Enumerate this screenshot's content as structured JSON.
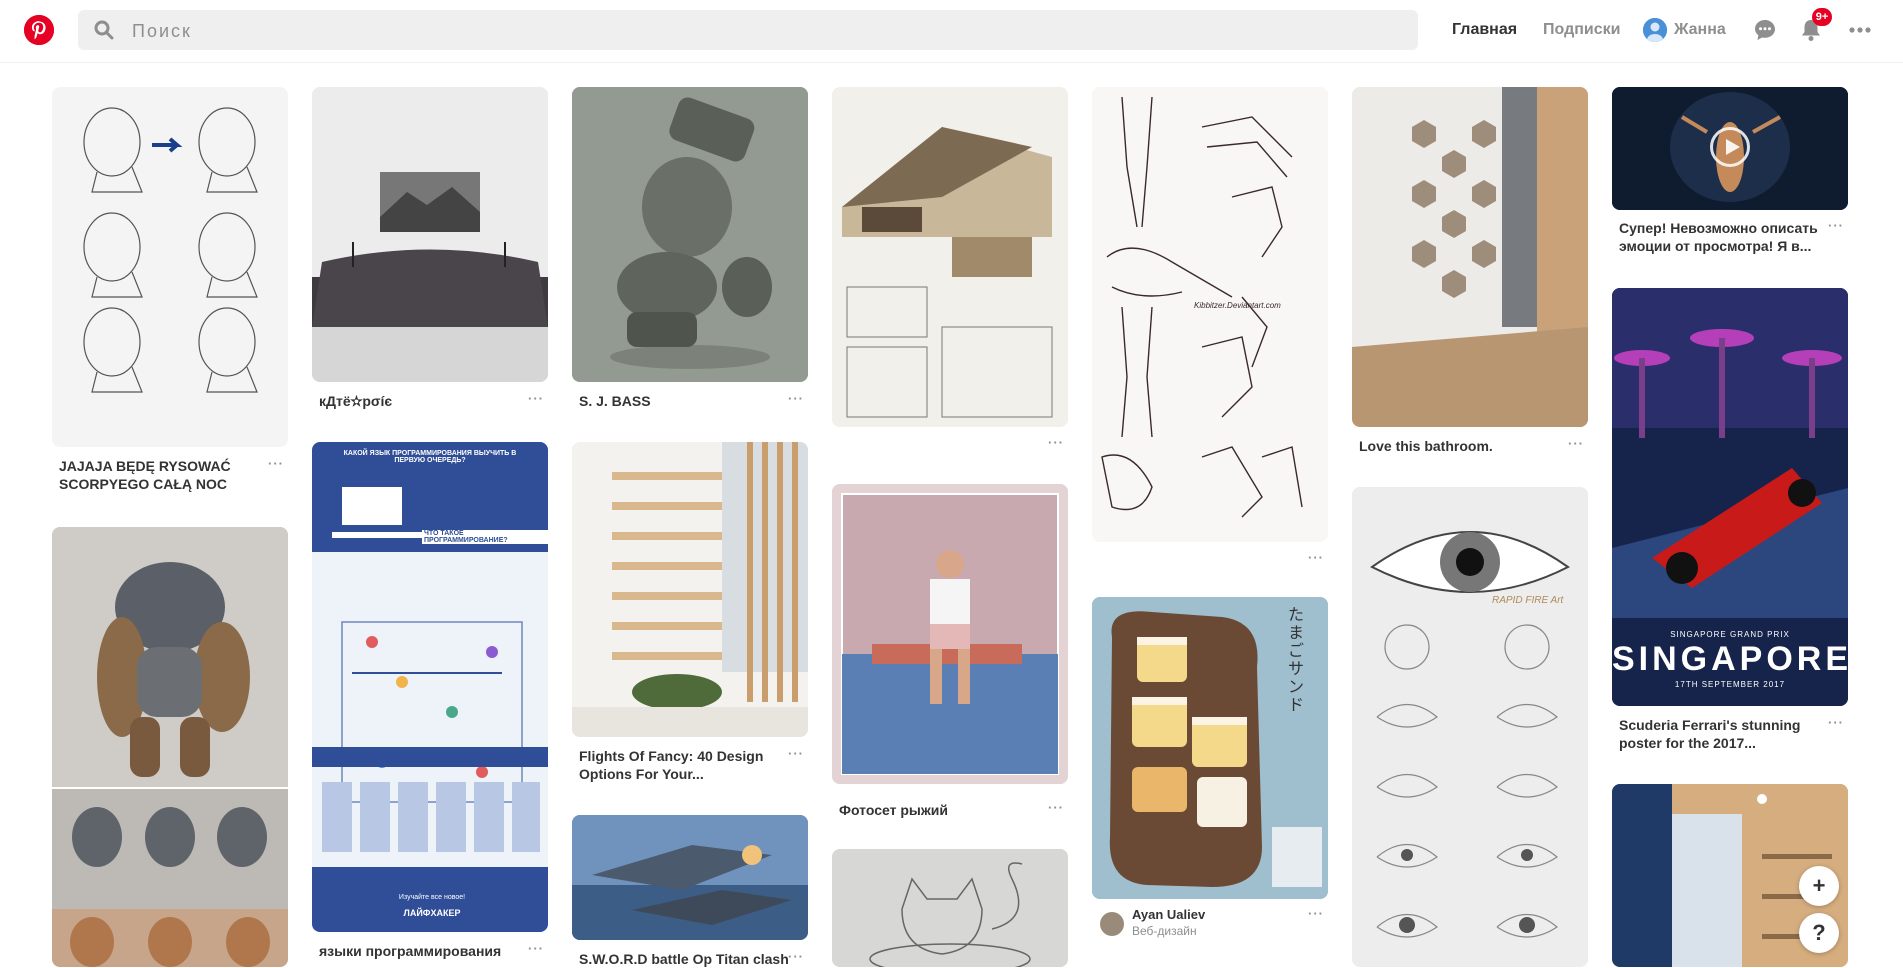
{
  "header": {
    "search_placeholder": "Поиск",
    "nav_home": "Главная",
    "nav_following": "Подписки",
    "user_name": "Жанна",
    "notification_badge": "9+"
  },
  "pins": {
    "p1": {
      "title": "JAJAJA BĘDĘ RYSOWAĆ SCORPYEGO CAŁĄ NOC"
    },
    "p2": {
      "title": "кДтё✫рσíє"
    },
    "p3": {
      "title": "S. J. BASS"
    },
    "p5": {
      "title": "Love this bathroom."
    },
    "p6": {
      "title": "Супер! Невозможно описать эмоции от просмотра! Я в..."
    },
    "p8": {
      "title": "Flights Of Fancy: 40 Design Options For Your..."
    },
    "p9": {
      "title": "Фотосет рыжий"
    },
    "p10": {
      "author": "Ayan Ualiev",
      "board": "Веб-дизайн"
    },
    "p12": {
      "title": "Scuderia Ferrari's stunning poster for the 2017..."
    },
    "p14": {
      "title": "языки программирования"
    },
    "p15": {
      "title": "S.W.O.R.D battle Op Titan clash"
    }
  },
  "image_text": {
    "singapore_title": "SINGAPORE",
    "singapore_sub": "SINGAPORE GRAND PRIX",
    "singapore_date": "17TH SEPTEMBER 2017",
    "infographic_top": "КАКОЙ ЯЗЫК ПРОГРАММИРОВАНИЯ ВЫУЧИТЬ В ПЕРВУЮ ОЧЕРЕДЬ?",
    "infographic_q": "ЧТО ТАКОЕ ПРОГРАММИРОВАНИЕ?",
    "infographic_brand": "ЛАЙФХАКЕР",
    "infographic_cta": "Изучайте все новое!",
    "eye_watermark": "RAPID FIRE Art",
    "sandwich_jp": "たまごサンド",
    "legs_watermark": "Kibbitzer.Deviantart.com"
  },
  "fab": {
    "add": "+",
    "help": "?"
  },
  "more_label": "···",
  "colors": {
    "brand": "#e60023",
    "muted": "#8e8e8e",
    "text": "#333333"
  }
}
